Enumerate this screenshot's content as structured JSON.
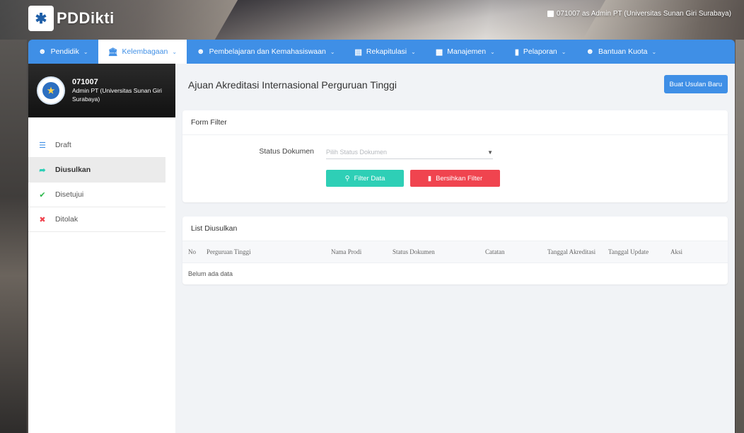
{
  "brand": {
    "name": "PDDikti"
  },
  "top_user": {
    "text": "071007 as Admin PT (Universitas Sunan Giri Surabaya)"
  },
  "nav": [
    {
      "label": "Pendidik"
    },
    {
      "label": "Kelembagaan"
    },
    {
      "label": "Pembelajaran dan Kemahasiswaan"
    },
    {
      "label": "Rekapitulasi"
    },
    {
      "label": "Manajemen"
    },
    {
      "label": "Pelaporan"
    },
    {
      "label": "Bantuan Kuota"
    }
  ],
  "profile": {
    "code": "071007",
    "name": "Admin PT (Universitas Sunan Giri Surabaya)"
  },
  "sidebar": {
    "items": [
      {
        "label": "Draft"
      },
      {
        "label": "Diusulkan"
      },
      {
        "label": "Disetujui"
      },
      {
        "label": "Ditolak"
      }
    ]
  },
  "page": {
    "title": "Ajuan Akreditasi Internasional Perguruan Tinggi",
    "new_button": "Buat Usulan Baru"
  },
  "filter": {
    "title": "Form Filter",
    "status_label": "Status Dokumen",
    "status_placeholder": "Pilih Status Dokumen",
    "filter_button": "Filter Data",
    "clear_button": "Bersihkan Filter"
  },
  "list": {
    "title": "List Diusulkan",
    "columns": [
      "No",
      "Perguruan Tinggi",
      "Nama Prodi",
      "Status Dokumen",
      "Catatan",
      "Tanggal Akreditasi",
      "Tanggal Update",
      "Aksi"
    ],
    "empty_text": "Belum ada data"
  },
  "colors": {
    "primary": "#3f8fe6",
    "success": "#2ecfb6",
    "danger": "#f0444f"
  }
}
